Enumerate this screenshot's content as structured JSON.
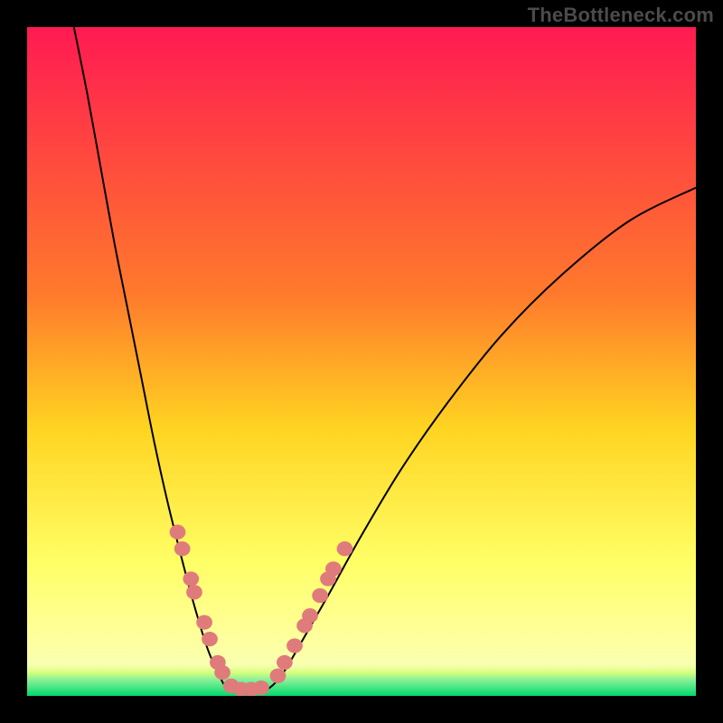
{
  "watermark": "TheBottleneck.com",
  "chart_data": {
    "type": "line",
    "title": "",
    "xlabel": "",
    "ylabel": "",
    "xlim": [
      0,
      100
    ],
    "ylim": [
      0,
      100
    ],
    "grid": false,
    "legend": false,
    "background_gradient": {
      "top": "#ff1a52",
      "upper_mid": "#ff7a2c",
      "mid": "#ffd421",
      "lower_mid": "#ffff66",
      "lower_band": "#ffff99",
      "thin_band": "#d6ff7a",
      "bottom": "#00d96b"
    },
    "series": [
      {
        "name": "bottleneck-curve-left",
        "type": "line",
        "x": [
          7,
          9,
          11,
          13,
          15,
          17,
          19,
          21,
          23,
          25,
          27,
          29,
          30
        ],
        "y": [
          100,
          90,
          79,
          68,
          58,
          48,
          38,
          29,
          21,
          13.5,
          7,
          2.5,
          1
        ]
      },
      {
        "name": "bottleneck-curve-bottom",
        "type": "line",
        "x": [
          30,
          31,
          32,
          33,
          34,
          35,
          36
        ],
        "y": [
          1,
          0.6,
          0.5,
          0.5,
          0.5,
          0.6,
          1
        ]
      },
      {
        "name": "bottleneck-curve-right",
        "type": "line",
        "x": [
          36,
          38,
          41,
          45,
          50,
          56,
          63,
          71,
          80,
          90,
          100
        ],
        "y": [
          1,
          3,
          8,
          15,
          24,
          34,
          44,
          54,
          63,
          71,
          76
        ]
      }
    ],
    "markers": [
      {
        "name": "left-branch-dots",
        "color": "#e07b7b",
        "points": [
          {
            "x": 22.5,
            "y": 24.5
          },
          {
            "x": 23.2,
            "y": 22.0
          },
          {
            "x": 24.5,
            "y": 17.5
          },
          {
            "x": 25.0,
            "y": 15.5
          },
          {
            "x": 26.5,
            "y": 11.0
          },
          {
            "x": 27.3,
            "y": 8.5
          },
          {
            "x": 28.5,
            "y": 5.0
          },
          {
            "x": 29.2,
            "y": 3.5
          }
        ]
      },
      {
        "name": "right-branch-dots",
        "color": "#e07b7b",
        "points": [
          {
            "x": 37.5,
            "y": 3.0
          },
          {
            "x": 38.5,
            "y": 5.0
          },
          {
            "x": 40.0,
            "y": 7.5
          },
          {
            "x": 41.5,
            "y": 10.5
          },
          {
            "x": 42.3,
            "y": 12.0
          },
          {
            "x": 43.8,
            "y": 15.0
          },
          {
            "x": 45.0,
            "y": 17.5
          },
          {
            "x": 45.8,
            "y": 19.0
          },
          {
            "x": 47.5,
            "y": 22.0
          }
        ]
      },
      {
        "name": "valley-dots",
        "color": "#e07b7b",
        "points": [
          {
            "x": 30.5,
            "y": 1.5
          },
          {
            "x": 32.0,
            "y": 1.0
          },
          {
            "x": 33.5,
            "y": 1.0
          },
          {
            "x": 35.0,
            "y": 1.2
          }
        ]
      }
    ]
  }
}
